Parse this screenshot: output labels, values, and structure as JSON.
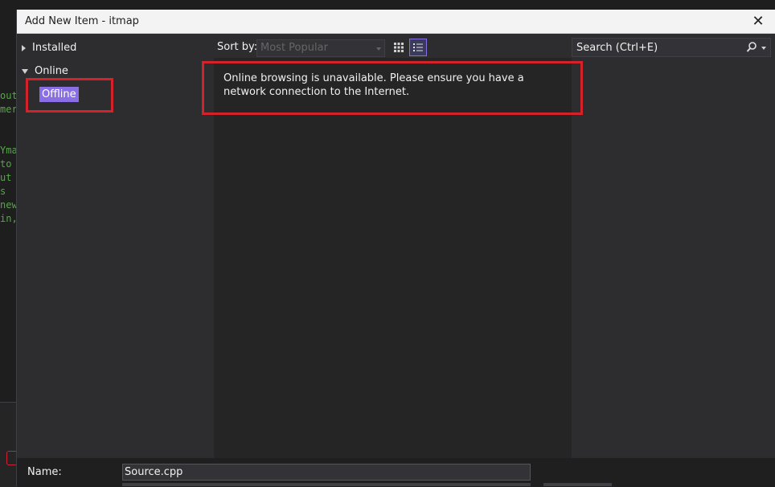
{
  "background": {
    "code_lines": [
      "out",
      " mer",
      "",
      "",
      "Ymar",
      " to",
      "ut ;",
      "s",
      "new",
      "in,"
    ]
  },
  "dialog": {
    "title": "Add New Item - itmap",
    "close_glyph": "✕"
  },
  "tree": {
    "installed_label": "Installed",
    "online_label": "Online",
    "offline_label": "Offline"
  },
  "toolbar": {
    "sort_label": "Sort by:",
    "sort_value": "Most Popular",
    "grid_view_icon": "grid-view-icon",
    "list_view_icon": "list-view-icon"
  },
  "content": {
    "message": "Online browsing is unavailable. Please ensure you have a network connection to the Internet."
  },
  "search": {
    "text": "Search (Ctrl+E)",
    "icon": "search-icon"
  },
  "footer": {
    "name_label": "Name:",
    "name_value": "Source.cpp"
  },
  "colors": {
    "accent": "#8a6ee6",
    "highlight_box": "#d3222a",
    "dialog_bg": "#2d2d30",
    "list_bg": "#252526"
  }
}
